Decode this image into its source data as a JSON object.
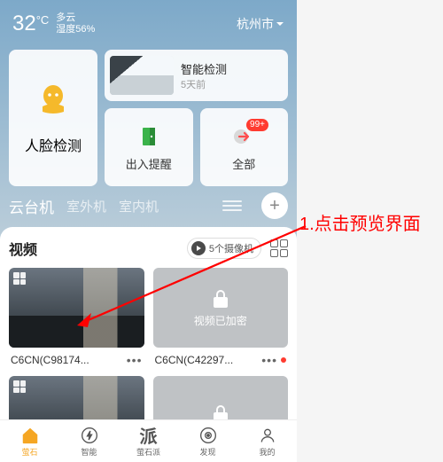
{
  "status": {
    "temp": "32",
    "degC": "°C",
    "weather": "多云",
    "humidity": "湿度56%",
    "city": "杭州市"
  },
  "cards": {
    "face": "人脸检测",
    "smart": {
      "title": "智能检测",
      "sub": "5天前"
    },
    "access": "出入提醒",
    "all": "全部",
    "badge": "99+"
  },
  "tabs": {
    "t1": "云台机",
    "t2": "室外机",
    "t3": "室内机"
  },
  "panel": {
    "title": "视频",
    "pill": "5个摄像机",
    "items": [
      {
        "name": "C6CN(C98174...",
        "locked": false,
        "red": false
      },
      {
        "name": "C6CN(C42297...",
        "locked": true,
        "red": true,
        "lockedText": "视频已加密"
      }
    ]
  },
  "tabbar": {
    "t1": "萤石",
    "t2": "智能",
    "t3": "萤石派",
    "t4": "发现",
    "t5": "我的"
  },
  "annotation": "1.点击预览界面"
}
